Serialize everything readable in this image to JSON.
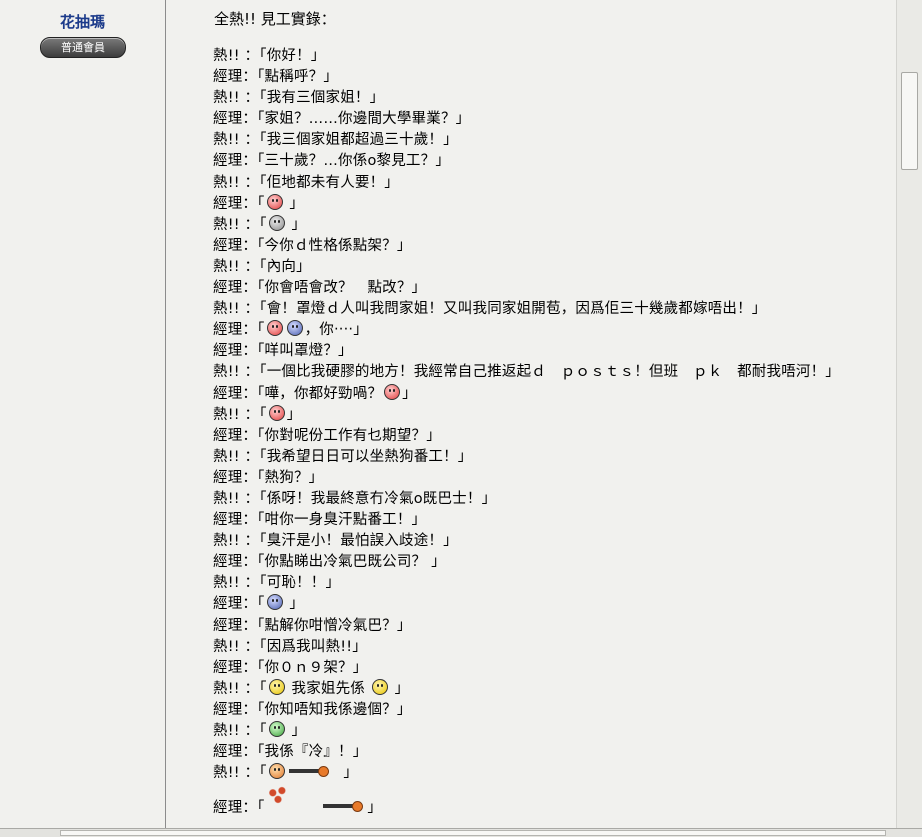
{
  "sidebar": {
    "username": "花抽瑪",
    "rank_badge": "普通會員"
  },
  "post": {
    "heading": "全熱!! 見工實錄：",
    "lines": [
      {
        "speaker": "熱!! ：",
        "text": "「你好！」"
      },
      {
        "speaker": "經理：",
        "text": "「點稱呼？」"
      },
      {
        "speaker": "熱!! ：",
        "text": "「我有三個家姐！」"
      },
      {
        "speaker": "經理：",
        "text": "「家姐？……你邊間大學畢業？」"
      },
      {
        "speaker": "熱!! ：",
        "text": "「我三個家姐都超過三十歲！」"
      },
      {
        "speaker": "經理：",
        "text": "「三十歲？…你係o黎見工？」"
      },
      {
        "speaker": "熱!! ：",
        "text": "「佢地都未有人要！」"
      },
      {
        "speaker": "經理：",
        "text": "「",
        "emoticons": [
          "red"
        ],
        "tail": " 」"
      },
      {
        "speaker": "熱!! ：",
        "text": "「",
        "emoticons": [
          "gray"
        ],
        "tail": " 」"
      },
      {
        "speaker": "經理：",
        "text": "「今你ｄ性格係點架？」"
      },
      {
        "speaker": "熱!! ：",
        "text": "「內向」"
      },
      {
        "speaker": "經理：",
        "text": "「你會唔會改？　點改？」"
      },
      {
        "speaker": "熱!! ：",
        "text": "「會！罩燈ｄ人叫我問家姐！又叫我同家姐開苞，因爲佢三十幾歲都嫁唔出！」"
      },
      {
        "speaker": "經理：",
        "text": "「",
        "emoticons": [
          "red",
          "blue"
        ],
        "tail": "，你‧‧‧‧」"
      },
      {
        "speaker": "經理：",
        "text": "「咩叫罩燈？」"
      },
      {
        "speaker": "熱!! ：",
        "text": "「一個比我硬膠的地方！我經常自己推返起ｄ　ｐｏｓｔｓ！但班　ｐｋ　都耐我唔河！」"
      },
      {
        "speaker": "經理：",
        "text": "「嘩，你都好勁喎？",
        "emoticons": [
          "red"
        ],
        "tail": "」"
      },
      {
        "speaker": "熱!! ：",
        "text": "「",
        "emoticons": [
          "red"
        ],
        "tail": "」"
      },
      {
        "speaker": "經理：",
        "text": "「你對呢份工作有乜期望？」"
      },
      {
        "speaker": "熱!! ：",
        "text": "「我希望日日可以坐熱狗番工！」"
      },
      {
        "speaker": "經理：",
        "text": "「熱狗？」"
      },
      {
        "speaker": "熱!! ：",
        "text": "「係呀！我最終意冇冷氣o既巴士！」"
      },
      {
        "speaker": "經理：",
        "text": "「咁你一身臭汗點番工！」"
      },
      {
        "speaker": "熱!! ：",
        "text": "「臭汗是小！最怕誤入歧途！」"
      },
      {
        "speaker": "經理：",
        "text": "「你點睇出冷氣巴既公司？ 」"
      },
      {
        "speaker": "熱!! ：",
        "text": "「可恥！！」"
      },
      {
        "speaker": "經理：",
        "text": "「",
        "emoticons": [
          "blue"
        ],
        "tail": " 」"
      },
      {
        "speaker": "經理：",
        "text": "「點解你咁憎冷氣巴？」"
      },
      {
        "speaker": "熱!! ：",
        "text": "「因爲我叫熱!!」"
      },
      {
        "speaker": "經理：",
        "text": "「你０ｎ９架？」"
      },
      {
        "speaker": "熱!! ：",
        "text": "「",
        "emoticons": [
          "yellow"
        ],
        "tail": " 我家姐先係 ",
        "emoticons2": [
          "yellow"
        ],
        "tail2": " 」"
      },
      {
        "speaker": "經理：",
        "text": "「你知唔知我係邊個？」"
      },
      {
        "speaker": "熱!! ：",
        "text": "「",
        "emoticons": [
          "green"
        ],
        "tail": " 」"
      },
      {
        "speaker": "經理：",
        "text": "「我係『冷』！」"
      },
      {
        "speaker": "熱!! ：",
        "text": "「",
        "emoticons": [
          "orange"
        ],
        "gun": true,
        "tail": "　」"
      },
      {
        "speaker": "經理：",
        "text": "「",
        "burst": true,
        "gun": true,
        "tail": " 」"
      }
    ]
  }
}
